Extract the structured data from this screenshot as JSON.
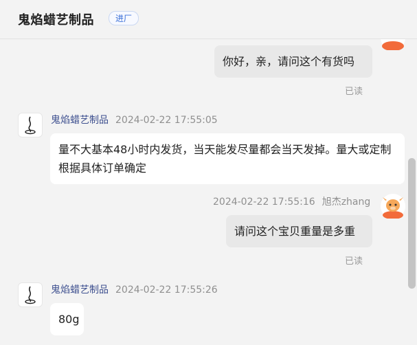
{
  "header": {
    "shop_name": "鬼焰蜡艺制品",
    "badge": "进厂"
  },
  "messages": {
    "m1": {
      "text": "你好，亲，请问这个有货吗",
      "status": "已读"
    },
    "m2": {
      "sender": "鬼焰蜡艺制品",
      "time": "2024-02-22 17:55:05",
      "text": "量不大基本48小时内发货，当天能发尽量都会当天发掉。量大或定制根据具体订单确定"
    },
    "m3": {
      "time": "2024-02-22 17:55:16",
      "sender": "旭杰zhang",
      "text": "请问这个宝贝重量是多重",
      "status": "已读"
    },
    "m4": {
      "sender": "鬼焰蜡艺制品",
      "time": "2024-02-22 17:55:26",
      "text": "80g"
    }
  },
  "colors": {
    "accent": "#3a6fd8",
    "avatar_orange": "#f26b3a",
    "sender_blue": "#3d4f8f"
  },
  "icons": {
    "shop_avatar": "shop-logo-icon",
    "user_avatar": "cartoon-cow-avatar-icon"
  }
}
